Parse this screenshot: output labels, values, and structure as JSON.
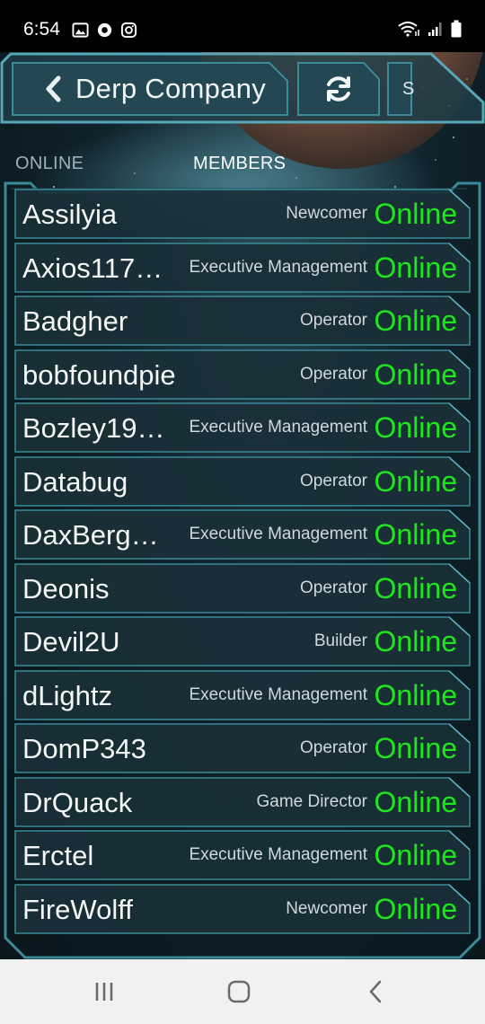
{
  "status_bar": {
    "time": "6:54",
    "left_icons": [
      "gallery-icon",
      "record-icon",
      "instagram-icon"
    ],
    "right_icons": [
      "wifi-icon",
      "signal-icon",
      "battery-icon"
    ]
  },
  "header": {
    "title": "Derp Company",
    "back_icon": "chevron-left-icon",
    "refresh_icon": "refresh-icon",
    "extra_tab_label": "S"
  },
  "tabs": [
    {
      "label": "ONLINE",
      "active": false
    },
    {
      "label": "MEMBERS",
      "active": true
    }
  ],
  "members": [
    {
      "name": "Assilyia",
      "rank": "Newcomer",
      "status": "Online"
    },
    {
      "name": "Axios117…",
      "rank": "Executive Management",
      "status": "Online"
    },
    {
      "name": "Badgher",
      "rank": "Operator",
      "status": "Online"
    },
    {
      "name": "bobfoundpie",
      "rank": "Operator",
      "status": "Online"
    },
    {
      "name": "Bozley19…",
      "rank": "Executive Management",
      "status": "Online"
    },
    {
      "name": "Databug",
      "rank": "Operator",
      "status": "Online"
    },
    {
      "name": "DaxBerge…",
      "rank": "Executive Management",
      "status": "Online"
    },
    {
      "name": "Deonis",
      "rank": "Operator",
      "status": "Online"
    },
    {
      "name": "Devil2U",
      "rank": "Builder",
      "status": "Online"
    },
    {
      "name": "dLightz",
      "rank": "Executive Management",
      "status": "Online"
    },
    {
      "name": "DomP343",
      "rank": "Operator",
      "status": "Online"
    },
    {
      "name": "DrQuack",
      "rank": "Game Director",
      "status": "Online"
    },
    {
      "name": "Erctel",
      "rank": "Executive Management",
      "status": "Online"
    },
    {
      "name": "FireWolff",
      "rank": "Newcomer",
      "status": "Online"
    }
  ],
  "nav_bar": {
    "buttons": [
      "recent-apps-icon",
      "home-icon",
      "back-icon"
    ]
  },
  "colors": {
    "online_green": "#1ee61e",
    "frame_cyan": "#3b8a98",
    "row_bg": "#1a2f37",
    "nav_bg": "#f1f1f1"
  }
}
